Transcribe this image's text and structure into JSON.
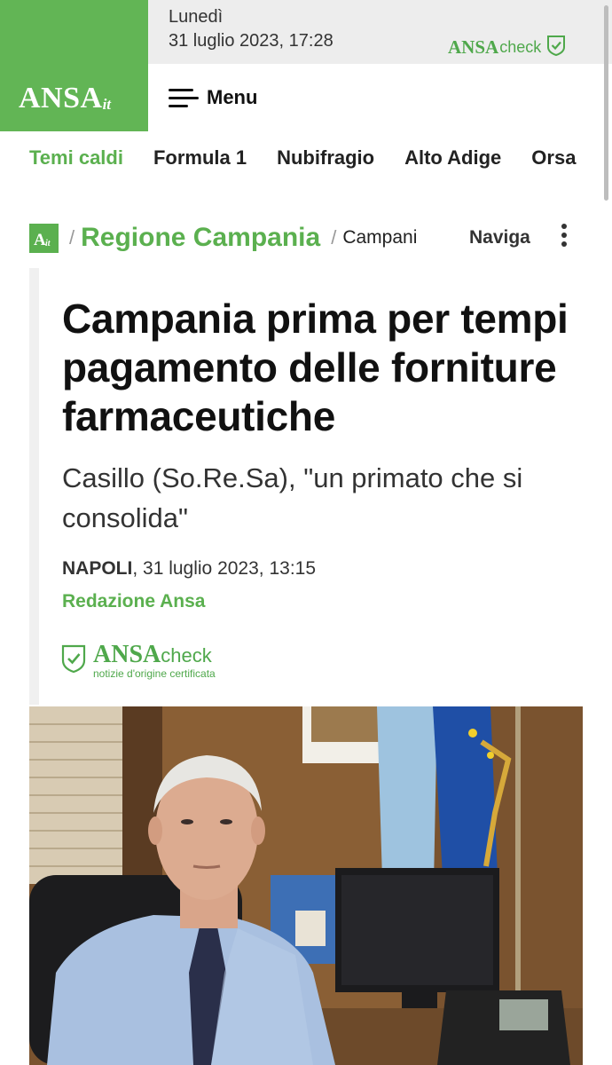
{
  "header": {
    "logo_main": "ANSA",
    "logo_suffix": "it",
    "day": "Lunedì",
    "datetime": "31 luglio 2023, 17:28",
    "menu_label": "Menu",
    "ansacheck": {
      "brand": "ANSA",
      "suffix": "check"
    }
  },
  "topics": [
    {
      "label": "Temi caldi",
      "highlight": true
    },
    {
      "label": "Formula 1",
      "highlight": false
    },
    {
      "label": "Nubifragio",
      "highlight": false
    },
    {
      "label": "Alto Adige",
      "highlight": false
    },
    {
      "label": "Orsa",
      "highlight": false
    }
  ],
  "breadcrumb": {
    "logo_text": "A it",
    "region": "Regione Campania",
    "section": "Campani",
    "navigate": "Naviga"
  },
  "article": {
    "headline": "Campania prima per tempi pagamento delle forniture farmaceutiche",
    "subhead": "Casillo (So.Re.Sa), \"un primato che si consolida\"",
    "place": "NAPOLI",
    "date": ", 31 luglio 2023, 13:15",
    "byline": "Redazione Ansa",
    "badge": {
      "brand": "ANSA",
      "suffix": "check",
      "tagline": "notizie d'origine certificata"
    }
  },
  "colors": {
    "brand_green": "#62b555",
    "text_green": "#5bb04f",
    "date_bar_bg": "#ededed"
  },
  "icons": [
    "menu-icon",
    "shield-check-icon",
    "more-vertical-icon"
  ]
}
